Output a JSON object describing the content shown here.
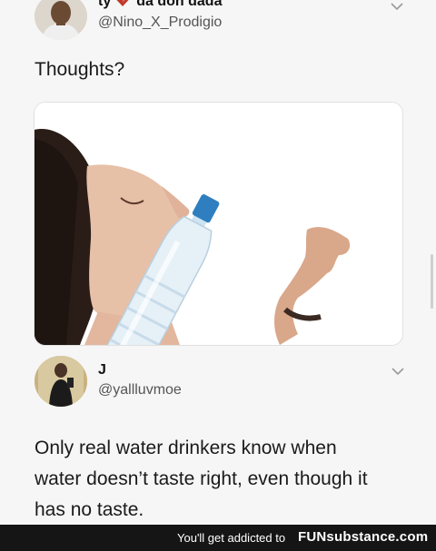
{
  "tweet1": {
    "display_name_left": "ty",
    "display_name_right": "da don dada",
    "handle": "@Nino_X_Prodigio",
    "text": "Thoughts?"
  },
  "tweet2": {
    "display_name": "J",
    "handle": "@yallluvmoe",
    "text_lines": [
      "Only real water drinkers know when",
      "water doesn’t taste right, even though it",
      "has no taste."
    ]
  },
  "footer": {
    "promo": "You'll get addicted to",
    "brand": "FUNsubstance.com"
  },
  "icons": {
    "heart": "broken-heart-icon",
    "menu": "chevron-down-icon"
  },
  "colors": {
    "background": "#f6f6f6",
    "heart": "#c0392b",
    "footer": "#151515"
  }
}
